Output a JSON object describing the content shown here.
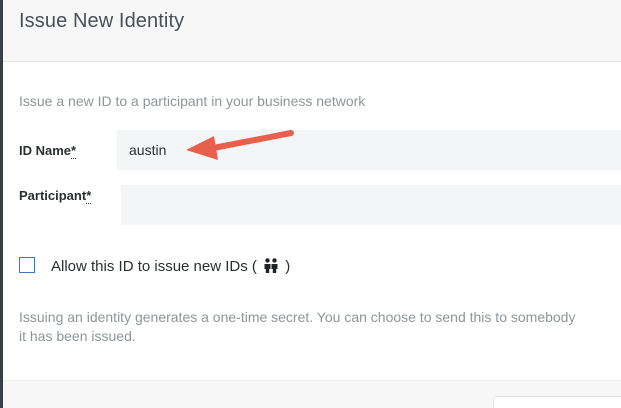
{
  "dialog": {
    "title": "Issue New Identity"
  },
  "form": {
    "intro": "Issue a new ID to a participant in your business network",
    "id_name": {
      "label": "ID Name",
      "required_mark": "*",
      "value": "austin"
    },
    "participant": {
      "label": "Participant",
      "required_mark": "*",
      "value": ""
    },
    "allow_issue": {
      "label_before": "Allow this ID to issue new IDs (",
      "label_after": ")",
      "icon": "people-icon",
      "checked": false
    },
    "note": "Issuing an identity generates a one-time secret. You can choose to send this to somebody",
    "note_line2": "it has been issued."
  },
  "annotation": {
    "icon": "arrow-icon",
    "color": "#e8604d"
  },
  "colors": {
    "header_bg": "#f7f7f8",
    "input_bg": "#f4f5f6",
    "checkbox_border": "#3b78c2"
  }
}
